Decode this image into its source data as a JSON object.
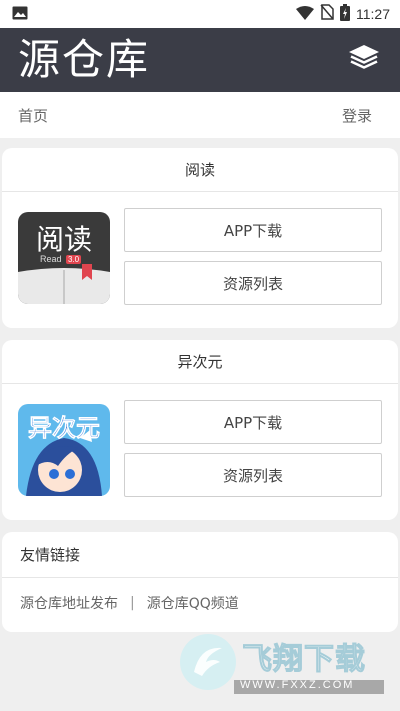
{
  "status_bar": {
    "time": "11:27",
    "icons": [
      "image-icon",
      "wifi-icon",
      "no-sim-icon",
      "battery-charging-icon"
    ]
  },
  "header": {
    "title": "源仓库",
    "menu_icon": "layers-icon"
  },
  "nav": {
    "home": "首页",
    "login": "登录"
  },
  "cards": [
    {
      "title": "阅读",
      "icon_text": "阅读",
      "icon_sub": "Read",
      "icon_badge": "3.0",
      "download_label": "APP下载",
      "resources_label": "资源列表"
    },
    {
      "title": "异次元",
      "icon_text": "异次元",
      "download_label": "APP下载",
      "resources_label": "资源列表"
    }
  ],
  "links": {
    "title": "友情链接",
    "items": [
      "源仓库地址发布",
      "源仓库QQ频道"
    ],
    "separator": "|"
  },
  "watermark": {
    "text": "飞翔下载",
    "url": "WWW.FXXZ.COM"
  },
  "colors": {
    "header_bg": "#3b3d47",
    "page_bg": "#efefef",
    "yiciyuan_blue": "#2b6fd6",
    "read_badge": "#e0454f"
  }
}
